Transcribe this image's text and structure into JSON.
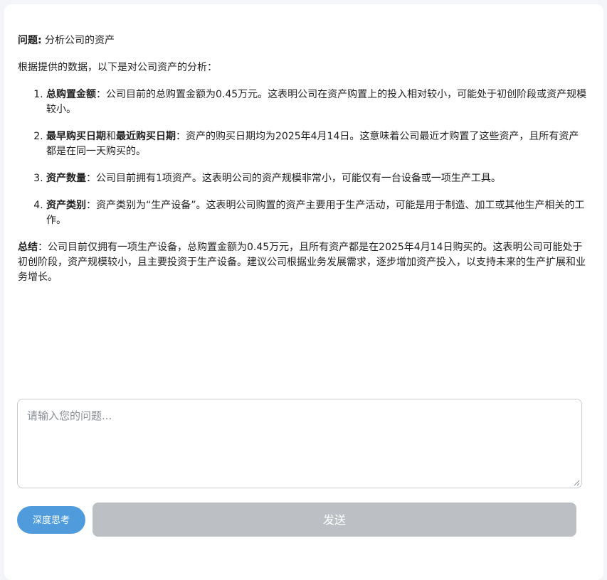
{
  "answer": {
    "question_label": "问题:",
    "question_text": " 分析公司的资产",
    "intro": "根据提供的数据，以下是对公司资产的分析：",
    "points": [
      {
        "title": "总购置金额",
        "text": "：公司目前的总购置金额为0.45万元。这表明公司在资产购置上的投入相对较小，可能处于初创阶段或资产规模较小。"
      },
      {
        "title": "最早购买日期",
        "middle": "和",
        "title2": "最近购买日期",
        "text": "：资产的购买日期均为2025年4月14日。这意味着公司最近才购置了这些资产，且所有资产都是在同一天购买的。"
      },
      {
        "title": "资产数量",
        "text": "：公司目前拥有1项资产。这表明公司的资产规模非常小，可能仅有一台设备或一项生产工具。"
      },
      {
        "title": "资产类别",
        "text": "：资产类别为“生产设备”。这表明公司购置的资产主要用于生产活动，可能是用于制造、加工或其他生产相关的工作。"
      }
    ],
    "summary_label": "总结",
    "summary_text": "：公司目前仅拥有一项生产设备，总购置金额为0.45万元，且所有资产都是在2025年4月14日购买的。这表明公司可能处于初创阶段，资产规模较小，且主要投资于生产设备。建议公司根据业务发展需求，逐步增加资产投入，以支持未来的生产扩展和业务增长。"
  },
  "input": {
    "placeholder": "请输入您的问题...",
    "value": ""
  },
  "buttons": {
    "deep_think": "深度思考",
    "send": "发送"
  },
  "colors": {
    "deep_think_bg": "#4f9bdb",
    "send_bg_disabled": "#bcc0c4",
    "page_bg": "#f4f5f8"
  }
}
